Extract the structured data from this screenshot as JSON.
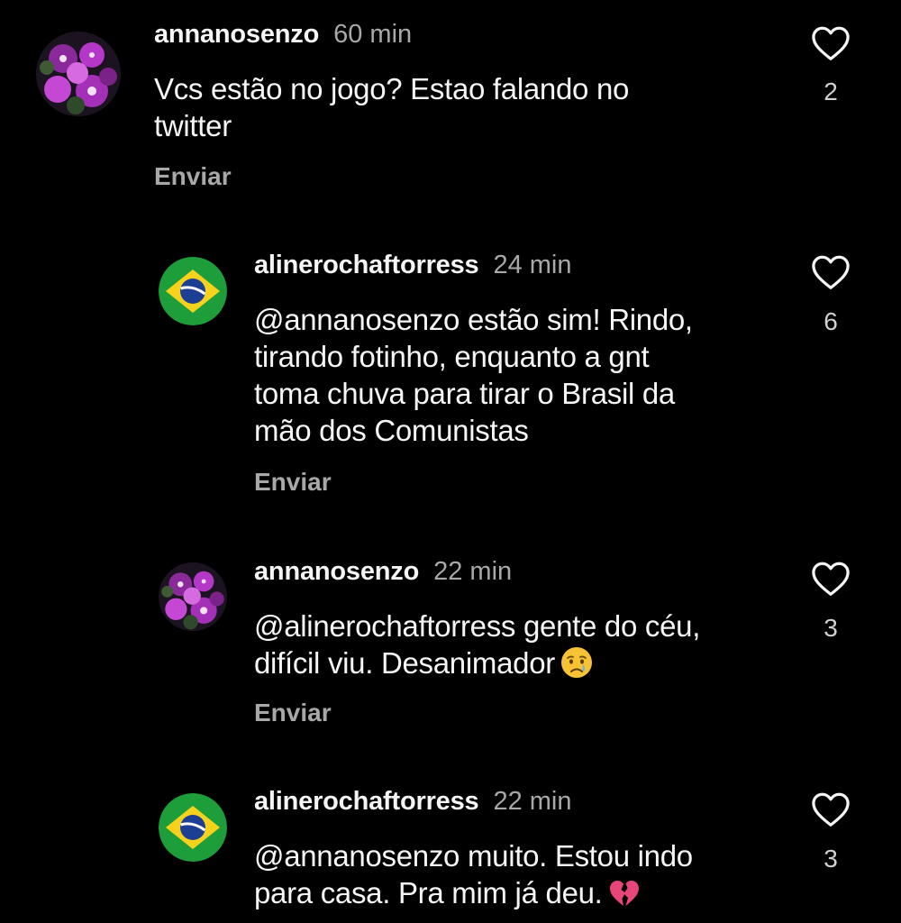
{
  "comments": [
    {
      "username": "annanosenzo",
      "time": "60 min",
      "text_lines": [
        "Vcs estão no jogo? Estao falando no",
        "twitter"
      ],
      "reply_label": "Enviar",
      "likes": "2",
      "avatar_icon": "purple-flower-avatar"
    },
    {
      "username": "alinerochaftorress",
      "time": "24 min",
      "text_lines": [
        "@annanosenzo estão sim! Rindo,",
        "tirando fotinho, enquanto a gnt",
        "toma chuva para tirar o Brasil da",
        "mão dos Comunistas"
      ],
      "reply_label": "Enviar",
      "likes": "6",
      "avatar_icon": "brazil-flag-avatar"
    },
    {
      "username": "annanosenzo",
      "time": "22 min",
      "text_lines": [
        "@alinerochaftorress gente do céu,",
        "difícil viu. Desanimador"
      ],
      "reply_label": "Enviar",
      "likes": "3",
      "avatar_icon": "purple-flower-avatar",
      "emoji": "crying-face-emoji"
    },
    {
      "username": "alinerochaftorress",
      "time": "22 min",
      "text_lines": [
        "@annanosenzo muito. Estou indo",
        "para casa. Pra mim já deu."
      ],
      "likes": "3",
      "avatar_icon": "brazil-flag-avatar",
      "emoji": "broken-heart-emoji"
    }
  ],
  "colors": {
    "background": "#000000",
    "primary_text": "#f5f5f5",
    "secondary_text": "#a8a8a8",
    "flag_green": "#1e9e3a",
    "flag_yellow": "#f6d21c",
    "flag_blue": "#1c3f94",
    "flower_purple": "#b437c8"
  },
  "icons": {
    "like": "heart-outline-icon"
  }
}
